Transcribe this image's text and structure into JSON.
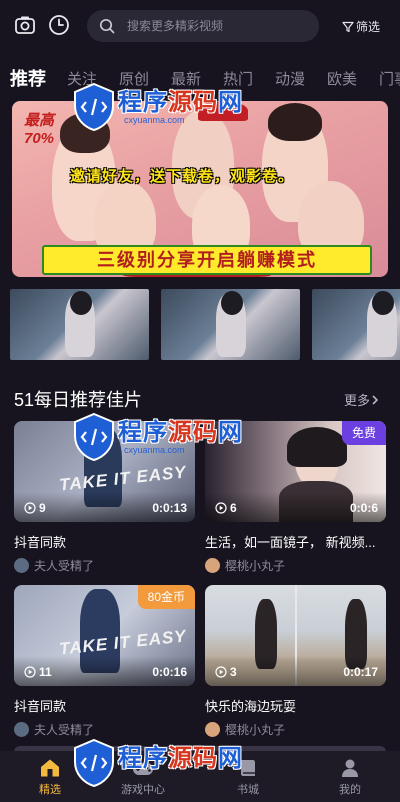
{
  "header": {
    "search_placeholder": "搜索更多精彩视频",
    "filter_label": "筛选",
    "icons": [
      "camera-icon",
      "history-clock-icon",
      "search-icon",
      "filter-funnel-icon"
    ]
  },
  "tabs": [
    "推荐",
    "关注",
    "原创",
    "最新",
    "热门",
    "动漫",
    "欧美",
    "门事"
  ],
  "banner": {
    "corner_line1": "最高",
    "corner_line2": "70%",
    "headline": "邀请好友，送下载卷，观影卷。",
    "ribbon": "三级别分享开启躺赚模式"
  },
  "section": {
    "title": "51每日推荐佳片",
    "more_label": "更多"
  },
  "cards": [
    {
      "title": "抖音同款",
      "author": "夫人受精了",
      "plays": "9",
      "duration": "0:0:13",
      "badge": "",
      "overlay": "TAKE IT EASY"
    },
    {
      "title": "生活，如一面镜子， 新视频...",
      "author": "樱桃小丸子",
      "plays": "6",
      "duration": "0:0:6",
      "badge": "免费",
      "overlay": ""
    },
    {
      "title": "抖音同款",
      "author": "夫人受精了",
      "plays": "11",
      "duration": "0:0:16",
      "badge": "80金币",
      "overlay": "TAKE IT EASY"
    },
    {
      "title": "快乐的海边玩耍",
      "author": "樱桃小丸子",
      "plays": "3",
      "duration": "0:0:17",
      "badge": "",
      "overlay": ""
    }
  ],
  "watermark": {
    "brand": "程序源码网",
    "url": "cxyuanma.com"
  },
  "bottom_nav": [
    {
      "label": "精选",
      "icon": "home-icon",
      "active": true
    },
    {
      "label": "游戏中心",
      "icon": "game-icon",
      "active": false
    },
    {
      "label": "书城",
      "icon": "book-icon",
      "active": false
    },
    {
      "label": "我的",
      "icon": "user-icon",
      "active": false
    }
  ],
  "colors": {
    "background": "#17141f",
    "accent": "#f3b83e",
    "badge_free": "#6b3fe0",
    "badge_coin": "#f29a3c"
  }
}
